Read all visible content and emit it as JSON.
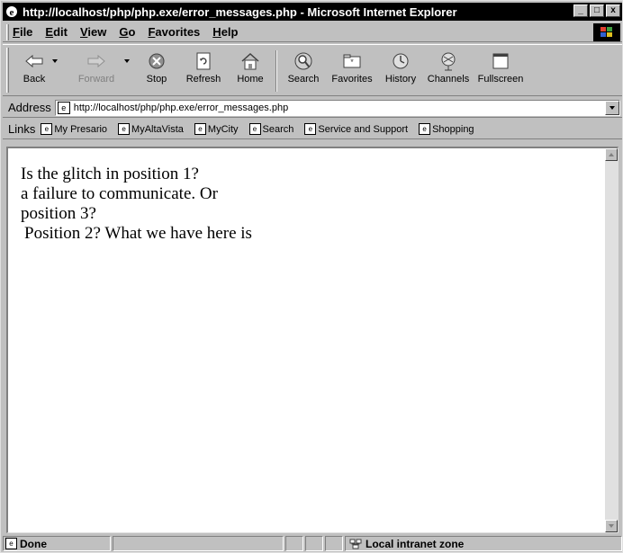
{
  "window": {
    "title": "http://localhost/php/php.exe/error_messages.php - Microsoft Internet Explorer",
    "controls": {
      "minimize": "_",
      "maximize": "□",
      "close": "x"
    }
  },
  "menu": [
    "File",
    "Edit",
    "View",
    "Go",
    "Favorites",
    "Help"
  ],
  "toolbar": {
    "back": "Back",
    "forward": "Forward",
    "stop": "Stop",
    "refresh": "Refresh",
    "home": "Home",
    "search": "Search",
    "favorites": "Favorites",
    "history": "History",
    "channels": "Channels",
    "fullscreen": "Fullscreen"
  },
  "address": {
    "label": "Address",
    "url": "http://localhost/php/php.exe/error_messages.php"
  },
  "links": {
    "label": "Links",
    "items": [
      "My Presario",
      "MyAltaVista",
      "MyCity",
      "Search",
      "Service and Support",
      "Shopping"
    ]
  },
  "page": {
    "lines": [
      "Is the glitch in position 1?",
      "a failure to communicate. Or",
      "position 3?",
      "Position 2? What we have here is"
    ]
  },
  "status": {
    "text": "Done",
    "zone": "Local intranet zone"
  }
}
